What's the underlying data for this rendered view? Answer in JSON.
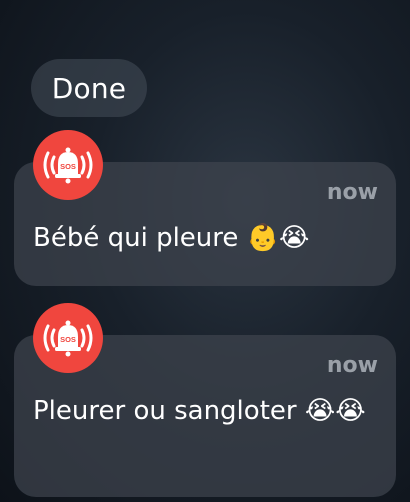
{
  "header": {
    "done_label": "Done"
  },
  "notifications": [
    {
      "app_icon": "sos-bell-icon",
      "app_icon_text": "SOS",
      "timestamp": "now",
      "message": "Bébé qui pleure 👶😭"
    },
    {
      "app_icon": "sos-bell-icon",
      "app_icon_text": "SOS",
      "timestamp": "now",
      "message": "Pleurer ou sangloter 😭😭"
    }
  ],
  "colors": {
    "icon_background": "#f0463e",
    "card_background": "#3e444e",
    "timestamp": "#9aa0a8"
  }
}
